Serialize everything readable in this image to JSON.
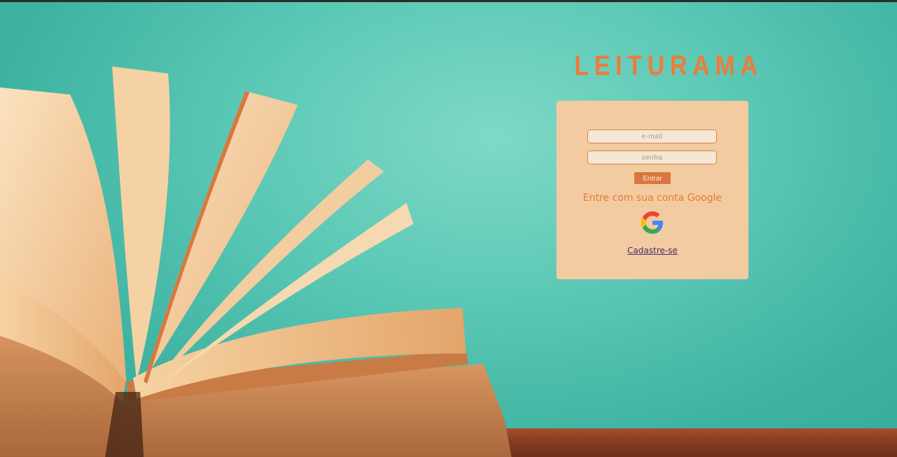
{
  "brand": {
    "title": "LEITURAMA"
  },
  "login": {
    "email_placeholder": "e-mail",
    "password_placeholder": "senha",
    "enter_label": "Entrar",
    "google_prompt": "Entre com sua conta Google",
    "google_icon": "google-g-icon",
    "signup_label": "Cadastre-se"
  },
  "colors": {
    "accent": "#ef7b3c",
    "card_bg": "#f3cba0",
    "background": "#5cc9b6",
    "button": "#d9773f",
    "link": "#4a2a6e"
  }
}
